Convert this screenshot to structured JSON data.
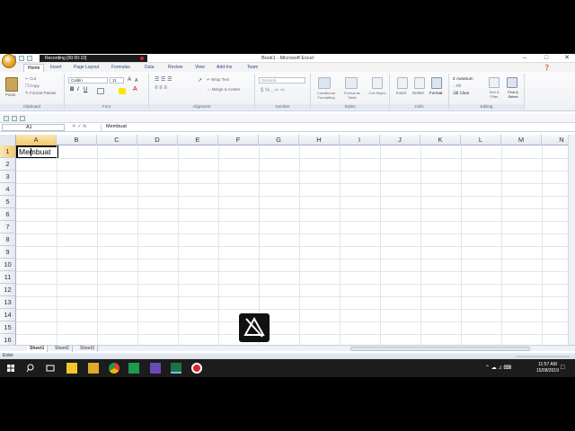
{
  "window": {
    "title": "Book1 - Microsoft Excel",
    "recording_label": "Recording [00:00:10]"
  },
  "tabs": [
    {
      "label": "Home",
      "active": true
    },
    {
      "label": "Insert"
    },
    {
      "label": "Page Layout"
    },
    {
      "label": "Formulas"
    },
    {
      "label": "Data"
    },
    {
      "label": "Review"
    },
    {
      "label": "View"
    },
    {
      "label": "Add-Ins"
    },
    {
      "label": "Team"
    }
  ],
  "ribbon": {
    "clipboard": {
      "label": "Clipboard",
      "paste": "Paste",
      "cut": "Cut",
      "copy": "Copy",
      "format_painter": "Format Painter"
    },
    "font": {
      "label": "Font",
      "name": "Calibri",
      "size": "11"
    },
    "alignment": {
      "label": "Alignment",
      "wrap_text": "Wrap Text",
      "merge_center": "Merge & Center"
    },
    "number": {
      "label": "Number",
      "format": "General"
    },
    "styles": {
      "label": "Styles",
      "conditional": "Conditional Formatting",
      "format_table": "Format as Table",
      "cell_styles": "Cell Styles"
    },
    "cells": {
      "label": "Cells",
      "insert": "Insert",
      "delete": "Delete",
      "format": "Format"
    },
    "editing": {
      "label": "Editing",
      "autosum": "AutoSum",
      "fill": "Fill",
      "clear": "Clear",
      "sort_filter": "Sort & Filter",
      "find_select": "Find & Select"
    }
  },
  "formula_bar": {
    "name_box": "A1",
    "fx": "fx",
    "content": "Membuat"
  },
  "grid": {
    "columns": [
      "A",
      "B",
      "C",
      "D",
      "E",
      "F",
      "G",
      "H",
      "I",
      "J",
      "K",
      "L",
      "M",
      "N"
    ],
    "rows": [
      "1",
      "2",
      "3",
      "4",
      "5",
      "6",
      "7",
      "8",
      "9",
      "10",
      "11",
      "12",
      "13",
      "14",
      "15",
      "16"
    ],
    "active_cell": "A1",
    "cells": {
      "A1": "Membuat"
    }
  },
  "sheets": [
    {
      "label": "Sheet1",
      "active": true
    },
    {
      "label": "Sheet2"
    },
    {
      "label": "Sheet3"
    }
  ],
  "status": {
    "mode": "Enter"
  },
  "taskbar": {
    "time": "11:57 AM",
    "date": "15/08/2019"
  },
  "colors": {
    "accent": "#2b579a",
    "selected_header": "#f5c76a",
    "taskbar": "#1c1c1c"
  }
}
